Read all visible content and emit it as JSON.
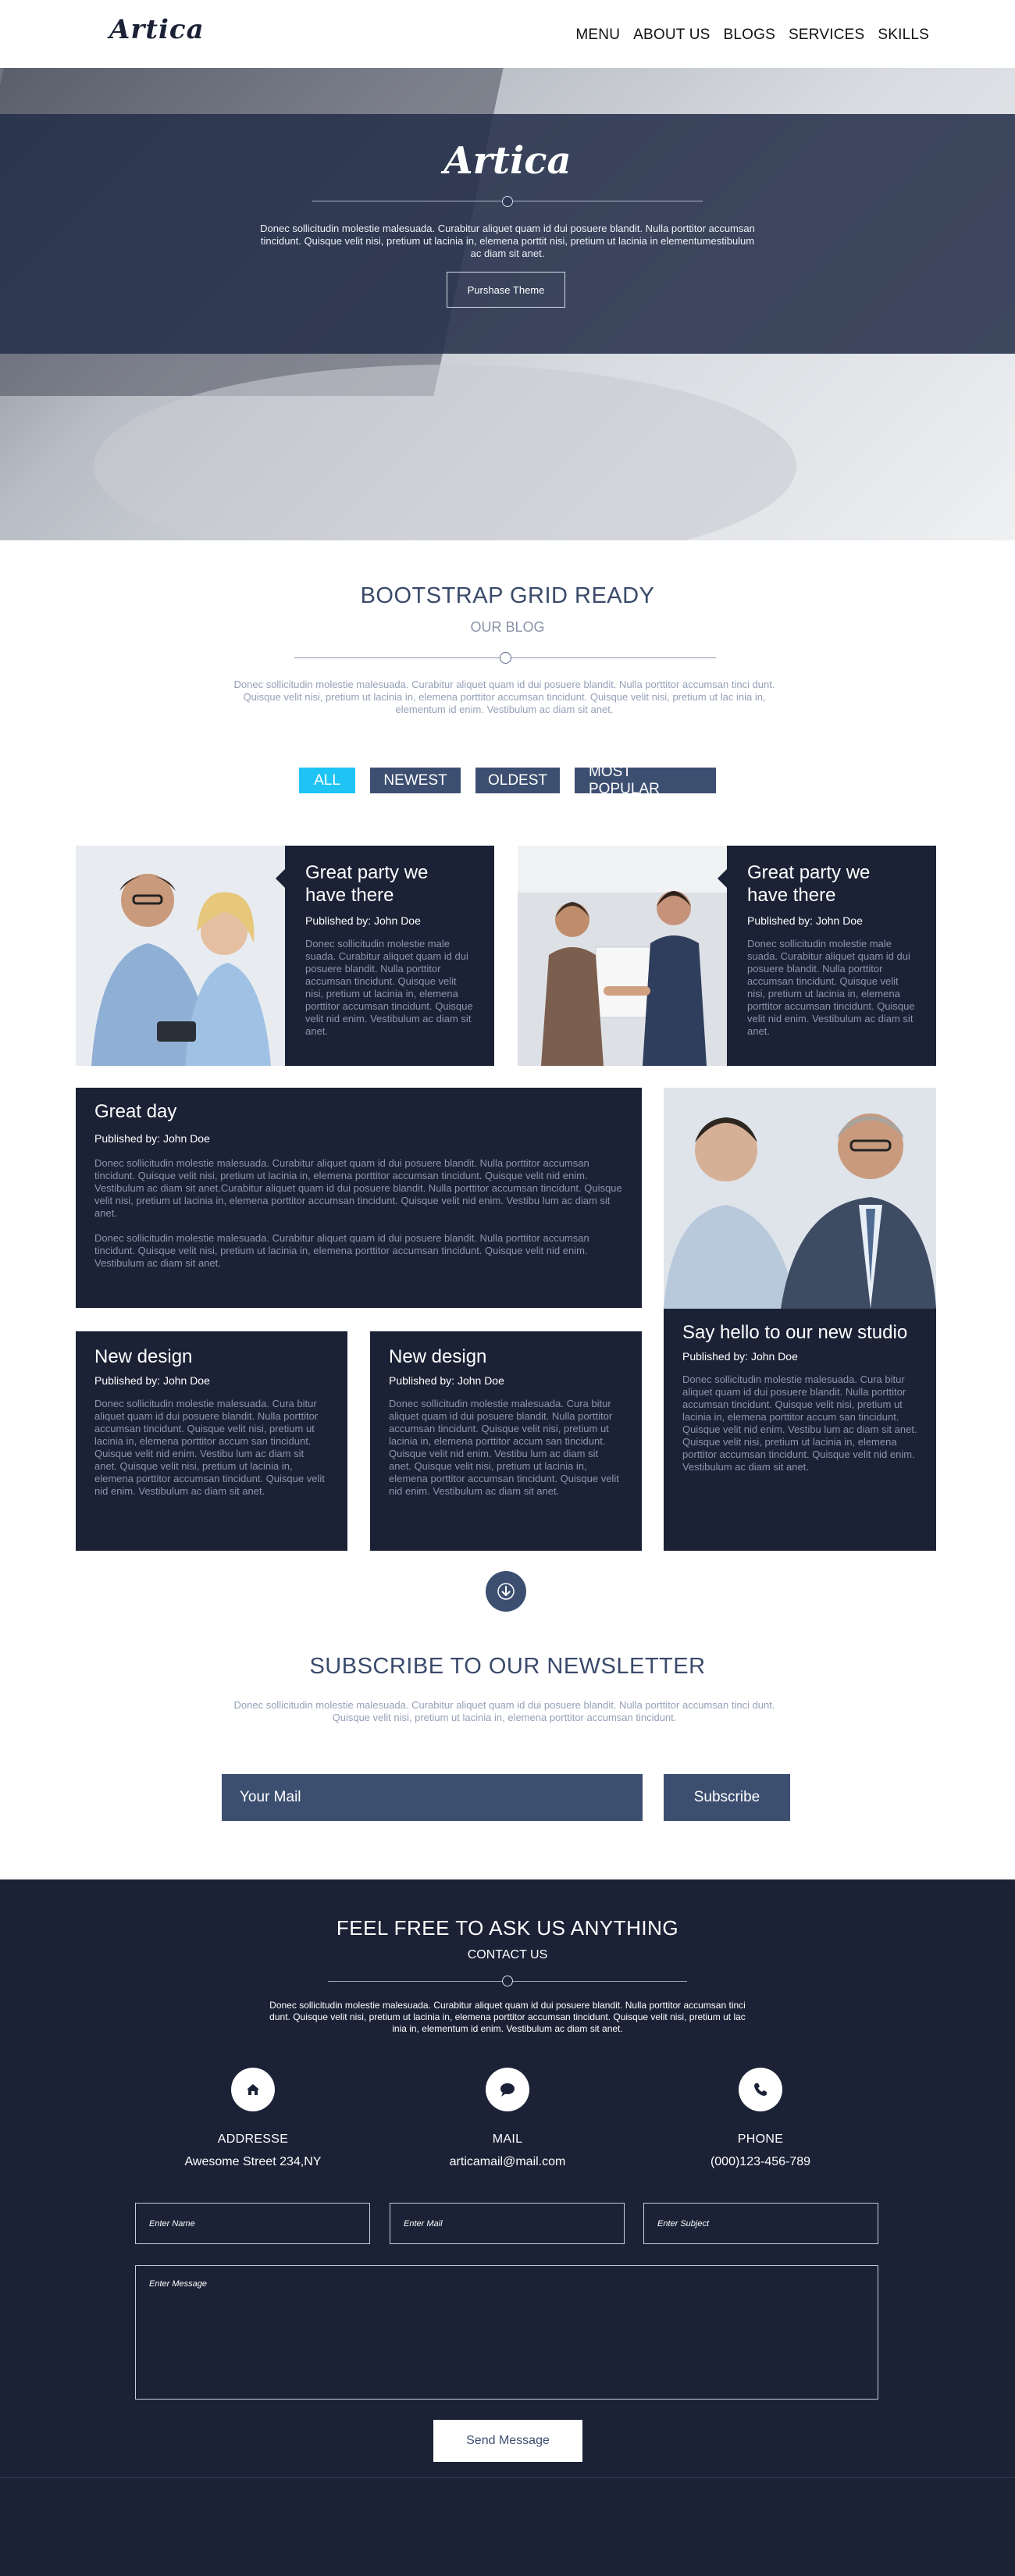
{
  "nav": {
    "logo": "Artica",
    "items": [
      "MENU",
      "ABOUT US",
      "BLOGS",
      "SERVICES",
      "SKILLS"
    ]
  },
  "hero": {
    "logo": "Artica",
    "text": "Donec sollicitudin molestie malesuada. Curabitur aliquet quam id dui posuere blandit. Nulla porttitor accumsan tincidunt. Quisque velit nisi, pretium ut lacinia in, elemena porttit nisi, pretium ut lacinia in elementumestibulum ac diam sit anet.",
    "button": "Purshase Theme"
  },
  "blog": {
    "title": "BOOTSTRAP GRID READY",
    "subtitle": "OUR BLOG",
    "text": "Donec sollicitudin molestie malesuada. Curabitur aliquet quam id dui posuere blandit. Nulla porttitor accumsan tinci dunt. Quisque velit nisi, pretium ut lacinia in, elemena porttitor accumsan tincidunt. Quisque velit nisi, pretium ut lac inia in, elementum id enim. Vestibulum ac diam sit anet.",
    "filters": [
      "ALL",
      "NEWEST",
      "OLDEST",
      "MOST POPULAR"
    ]
  },
  "cards": [
    {
      "title": "Great party we have there",
      "byline": "Published by: John Doe",
      "text": "Donec sollicitudin molestie male suada. Curabitur aliquet quam id dui posuere blandit. Nulla porttitor accumsan tincidunt. Quisque velit nisi, pretium ut lacinia in, elemena porttitor accumsan tincidunt. Quisque velit nid enim. Vestibulum ac diam sit anet."
    },
    {
      "title": "Great party we have there",
      "byline": "Published by: John Doe",
      "text": "Donec sollicitudin molestie male suada. Curabitur aliquet quam id dui posuere blandit. Nulla porttitor accumsan tincidunt. Quisque velit nisi, pretium ut lacinia in, elemena porttitor accumsan tincidunt. Quisque velit nid enim. Vestibulum ac diam sit anet."
    },
    {
      "title": "Great day",
      "byline": "Published by: John Doe",
      "text1": "Donec sollicitudin molestie malesuada. Curabitur aliquet quam id dui posuere blandit. Nulla porttitor accumsan tincidunt. Quisque velit nisi, pretium ut lacinia in, elemena porttitor accumsan tincidunt. Quisque velit nid enim. Vestibulum ac diam sit anet.Curabitur aliquet quam id dui posuere blandit. Nulla porttitor accumsan tincidunt. Quisque velit nisi, pretium ut lacinia in, elemena porttitor accumsan tincidunt. Quisque velit nid enim. Vestibu lum ac diam sit anet.",
      "text2": "Donec sollicitudin molestie malesuada. Curabitur aliquet quam id dui posuere blandit. Nulla porttitor accumsan tincidunt. Quisque velit nisi, pretium ut lacinia in, elemena porttitor accumsan tincidunt. Quisque velit nid enim. Vestibulum ac diam sit anet."
    },
    {
      "title": "Say hello to our new studio",
      "byline": "Published by: John Doe",
      "text": "Donec sollicitudin molestie malesuada. Cura bitur aliquet quam id dui posuere blandit. Nulla porttitor accumsan tincidunt. Quisque velit nisi, pretium ut lacinia in, elemena porttitor accum san tincidunt. Quisque velit nid enim. Vestibu lum ac diam sit anet. Quisque velit nisi, pretium ut lacinia in, elemena porttitor accumsan tincidunt. Quisque velit nid enim. Vestibulum ac diam sit anet."
    },
    {
      "title": "New design",
      "byline": "Published by: John Doe",
      "text": "Donec sollicitudin molestie malesuada. Cura bitur aliquet quam id dui posuere blandit. Nulla porttitor accumsan tincidunt. Quisque velit nisi, pretium ut lacinia in, elemena porttitor accum san tincidunt. Quisque velit nid enim. Vestibu lum ac diam sit anet. Quisque velit nisi, pretium ut lacinia in, elemena porttitor accumsan tincidunt. Quisque velit nid enim. Vestibulum ac diam sit anet."
    },
    {
      "title": "New design",
      "byline": "Published by: John Doe",
      "text": "Donec sollicitudin molestie malesuada. Cura bitur aliquet quam id dui posuere blandit. Nulla porttitor accumsan tincidunt. Quisque velit nisi, pretium ut lacinia in, elemena porttitor accum san tincidunt. Quisque velit nid enim. Vestibu lum ac diam sit anet. Quisque velit nisi, pretium ut lacinia in, elemena porttitor accumsan tincidunt. Quisque velit nid enim. Vestibulum ac diam sit anet."
    }
  ],
  "newsletter": {
    "title": "SUBSCRIBE TO OUR NEWSLETTER",
    "text": "Donec sollicitudin molestie malesuada. Curabitur aliquet quam id dui posuere blandit. Nulla porttitor accumsan tinci dunt. Quisque velit nisi, pretium ut lacinia in, elemena porttitor accumsan tincidunt.",
    "placeholder": "Your Mail",
    "button": "Subscribe"
  },
  "contact": {
    "title": "FEEL FREE TO ASK US ANYTHING",
    "subtitle": "CONTACT US",
    "text": "Donec sollicitudin molestie malesuada. Curabitur aliquet quam id dui posuere blandit. Nulla porttitor accumsan tinci dunt. Quisque velit nisi, pretium ut lacinia in, elemena porttitor accumsan tincidunt. Quisque velit nisi, pretium ut lac inia in, elementum id enim. Vestibulum ac diam sit anet.",
    "address_label": "ADDRESSE",
    "address_value": "Awesome Street 234,NY",
    "mail_label": "MAIL",
    "mail_value": "articamail@mail.com",
    "phone_label": "PHONE",
    "phone_value": "(000)123-456-789",
    "name_placeholder": "Enter Name",
    "mail_placeholder": "Enter Mail",
    "subject_placeholder": "Enter Subject",
    "message_placeholder": "Enter Message",
    "send_button": "Send Message"
  },
  "colors": {
    "navy": "#1b2236",
    "slate": "#3d4f71",
    "accent": "#1fc4f5"
  }
}
